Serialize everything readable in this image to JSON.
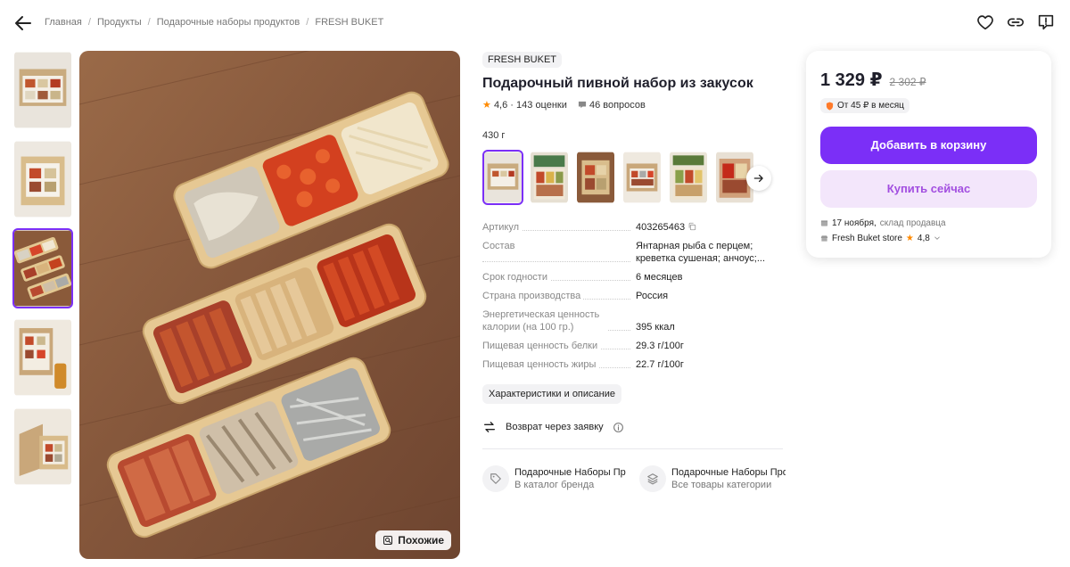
{
  "breadcrumbs": [
    "Главная",
    "Продукты",
    "Подарочные наборы продуктов",
    "FRESH BUKET"
  ],
  "product": {
    "brand": "FRESH BUKET",
    "title": "Подарочный пивной набор из закусок",
    "rating": "4,6",
    "ratings_count": "143 оценки",
    "questions": "46 вопросов",
    "weight": "430 г",
    "similar_label": "Похожие"
  },
  "specs": [
    {
      "key": "Артикул",
      "value": "403265463"
    },
    {
      "key": "Состав",
      "value": "Янтарная рыба с перцем; креветка сушеная; анчоус;..."
    },
    {
      "key": "Срок годности",
      "value": "6 месяцев"
    },
    {
      "key": "Страна производства",
      "value": "Россия"
    },
    {
      "key": "Энергетическая ценность калории (на 100 гр.)",
      "value": "395 ккал"
    },
    {
      "key": "Пищевая ценность белки",
      "value": "29.3 г/100г"
    },
    {
      "key": "Пищевая ценность жиры",
      "value": "22.7 г/100г"
    }
  ],
  "chars_button": "Характеристики и описание",
  "return_text": "Возврат через заявку",
  "links": [
    {
      "title": "Подарочные Наборы Пр",
      "sub": "В каталог бренда"
    },
    {
      "title": "Подарочные Наборы Прод",
      "sub": "Все товары категории"
    }
  ],
  "buy": {
    "price": "1 329 ₽",
    "old_price": "2 302 ₽",
    "installment": "От 45 ₽ в месяц",
    "add_to_cart": "Добавить в корзину",
    "buy_now": "Купить сейчас",
    "delivery_date": "17 ноября,",
    "delivery_source": "склад продавца",
    "seller": "Fresh Buket store",
    "seller_rating": "4,8"
  },
  "colors": {
    "accent": "#7b2ff7",
    "accent_light": "#f3e6fb",
    "star": "#ff8a00",
    "wood": "#8a5a3a"
  }
}
